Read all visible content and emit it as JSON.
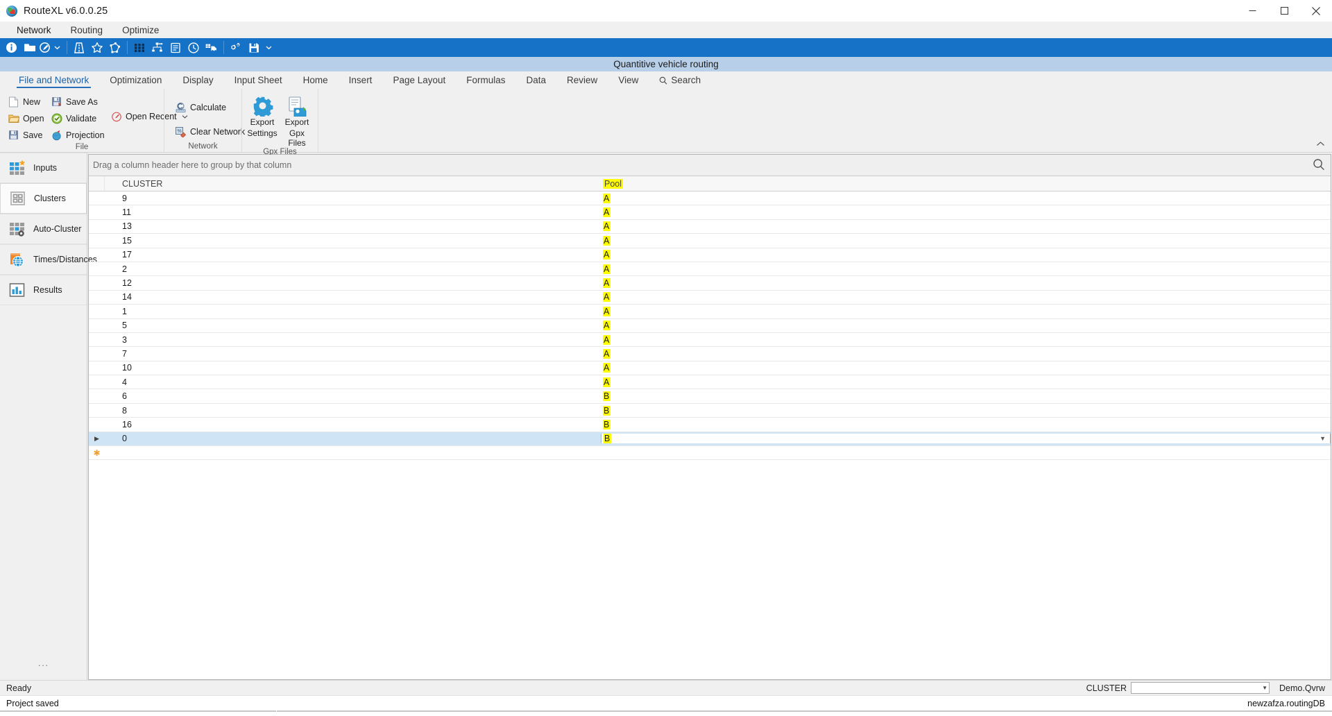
{
  "window": {
    "title": "RouteXL v6.0.0.25",
    "app_icon": "globe-icon",
    "minimize": "minimize-icon",
    "maximize": "maximize-icon",
    "close": "close-icon"
  },
  "menubar": {
    "items": [
      {
        "label": "Network",
        "active": true
      },
      {
        "label": "Routing",
        "active": false
      },
      {
        "label": "Optimize",
        "active": false
      }
    ]
  },
  "toolbar": {
    "buttons": [
      {
        "name": "info-icon"
      },
      {
        "name": "open-folder-icon"
      },
      {
        "name": "compass-icon"
      },
      {
        "name": "chevron-down-icon"
      },
      {
        "name": "road-icon"
      },
      {
        "name": "star-outline-icon"
      },
      {
        "name": "polygon-nodes-icon"
      },
      {
        "name": "grid-dots-icon"
      },
      {
        "name": "network-nodes-icon"
      },
      {
        "name": "document-list-icon"
      },
      {
        "name": "clock-icon"
      },
      {
        "name": "truck-icon"
      },
      {
        "name": "gears-icon"
      },
      {
        "name": "save-disk-icon"
      },
      {
        "name": "chevron-down-icon"
      }
    ]
  },
  "banner": {
    "title": "Quantitive vehicle routing"
  },
  "ribbon_tabs": [
    {
      "label": "File and Network",
      "active": true
    },
    {
      "label": "Optimization",
      "active": false
    },
    {
      "label": "Display",
      "active": false
    },
    {
      "label": "Input Sheet",
      "active": false
    },
    {
      "label": "Home",
      "active": false
    },
    {
      "label": "Insert",
      "active": false
    },
    {
      "label": "Page Layout",
      "active": false
    },
    {
      "label": "Formulas",
      "active": false
    },
    {
      "label": "Data",
      "active": false
    },
    {
      "label": "Review",
      "active": false
    },
    {
      "label": "View",
      "active": false
    },
    {
      "label": "Search",
      "active": false,
      "icon": "search-icon"
    }
  ],
  "ribbon": {
    "groups": [
      {
        "label": "File",
        "small_buttons_col1": [
          {
            "label": "New",
            "icon": "new-document-icon"
          },
          {
            "label": "Open",
            "icon": "open-folder-icon"
          },
          {
            "label": "Save",
            "icon": "save-disk-icon"
          }
        ],
        "small_buttons_col2": [
          {
            "label": "Save As",
            "icon": "save-as-icon"
          },
          {
            "label": "Validate",
            "icon": "validate-check-icon"
          },
          {
            "label": "Projection",
            "icon": "projection-globe-icon"
          }
        ],
        "small_buttons_col3": [
          {
            "label": "Open Recent",
            "icon": "open-recent-icon",
            "has_menu": true
          }
        ]
      },
      {
        "label": "Network",
        "small_buttons_col1": [
          {
            "label": "Calculate",
            "icon": "calculate-icon"
          },
          {
            "label": "Clear Network",
            "icon": "clear-network-icon"
          }
        ]
      },
      {
        "label": "Gpx Files",
        "big_buttons": [
          {
            "label_line1": "Export",
            "label_line2": "Settings",
            "icon": "gear-icon"
          },
          {
            "label_line1": "Export",
            "label_line2": "Gpx Files",
            "icon": "export-gpx-icon"
          }
        ]
      }
    ],
    "collapse_icon": "chevron-up-icon"
  },
  "sidebar": {
    "items": [
      {
        "label": "Inputs",
        "icon": "inputs-grid-icon",
        "selected": false
      },
      {
        "label": "Clusters",
        "icon": "clusters-grid-icon",
        "selected": true
      },
      {
        "label": "Auto-Cluster",
        "icon": "auto-cluster-icon",
        "selected": false
      },
      {
        "label": "Times/Distances",
        "icon": "times-distances-icon",
        "selected": false
      },
      {
        "label": "Results",
        "icon": "results-chart-icon",
        "selected": false
      }
    ],
    "overflow": "···"
  },
  "grid": {
    "group_hint": "Drag a column header here to group by that column",
    "search_icon": "search-icon",
    "columns": [
      {
        "key": "cluster",
        "label": "CLUSTER",
        "highlighted": false
      },
      {
        "key": "pool",
        "label": "Pool",
        "highlighted": true
      }
    ],
    "rows": [
      {
        "cluster": "9",
        "pool": "A",
        "selected": false
      },
      {
        "cluster": "11",
        "pool": "A",
        "selected": false
      },
      {
        "cluster": "13",
        "pool": "A",
        "selected": false
      },
      {
        "cluster": "15",
        "pool": "A",
        "selected": false
      },
      {
        "cluster": "17",
        "pool": "A",
        "selected": false
      },
      {
        "cluster": "2",
        "pool": "A",
        "selected": false
      },
      {
        "cluster": "12",
        "pool": "A",
        "selected": false
      },
      {
        "cluster": "14",
        "pool": "A",
        "selected": false
      },
      {
        "cluster": "1",
        "pool": "A",
        "selected": false
      },
      {
        "cluster": "5",
        "pool": "A",
        "selected": false
      },
      {
        "cluster": "3",
        "pool": "A",
        "selected": false
      },
      {
        "cluster": "7",
        "pool": "A",
        "selected": false
      },
      {
        "cluster": "10",
        "pool": "A",
        "selected": false
      },
      {
        "cluster": "4",
        "pool": "A",
        "selected": false
      },
      {
        "cluster": "6",
        "pool": "B",
        "selected": false
      },
      {
        "cluster": "8",
        "pool": "B",
        "selected": false
      },
      {
        "cluster": "16",
        "pool": "B",
        "selected": false
      },
      {
        "cluster": "0",
        "pool": "B",
        "selected": true
      }
    ],
    "new_row": {
      "cluster": "",
      "pool": "",
      "marker": "new-row-icon"
    }
  },
  "statusbar": {
    "ready_text": "Ready",
    "cluster_label": "CLUSTER",
    "cluster_value": "",
    "dropdown_icon": "chevron-down-icon",
    "file_name": "Demo.Qvrw",
    "project_status": "Project saved",
    "database": "newzafza.routingDB"
  }
}
